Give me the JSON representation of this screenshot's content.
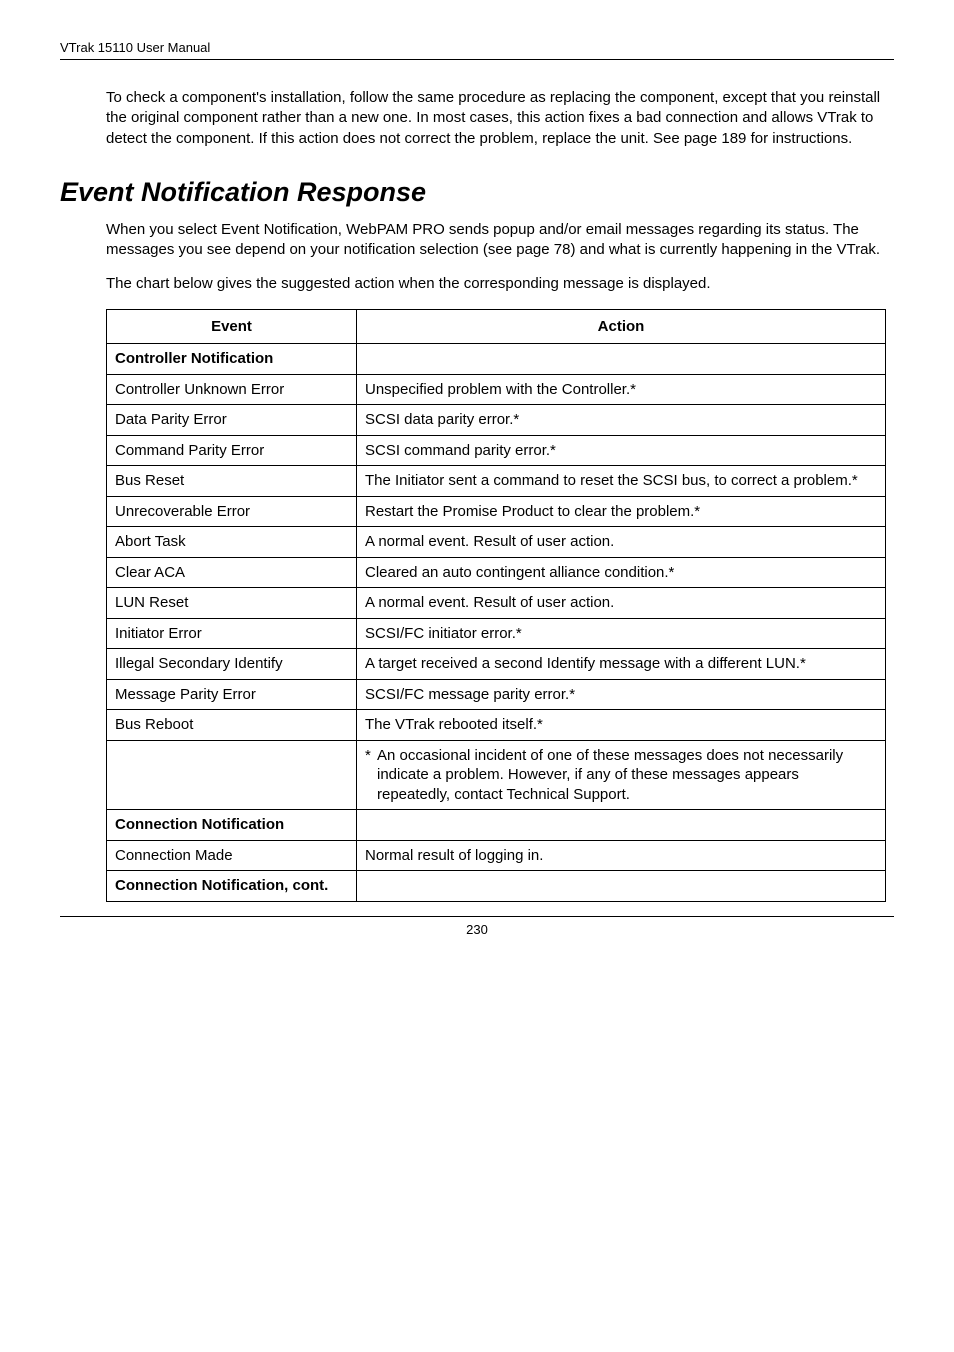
{
  "header": {
    "title": "VTrak 15110 User Manual"
  },
  "intro": "To check a component's installation, follow the same procedure as replacing the component, except that you reinstall the original component rather than a new one. In most cases, this action fixes a bad connection and allows VTrak to detect the component. If this action does not correct the problem, replace the unit. See page 189 for instructions.",
  "section": {
    "title": "Event Notification Response"
  },
  "para1": "When you select Event Notification, WebPAM PRO sends popup and/or email messages regarding its status. The messages you see depend on your notification selection (see page 78) and what is currently happening in the VTrak.",
  "para2": "The chart below gives the suggested action when the corresponding message is displayed.",
  "table": {
    "headers": {
      "event": "Event",
      "action": "Action"
    },
    "rows": [
      {
        "event": "Controller Notification",
        "action": "",
        "bold": true
      },
      {
        "event": "Controller Unknown Error",
        "action": "Unspecified problem with the Controller.*"
      },
      {
        "event": "Data Parity Error",
        "action": "SCSI data parity error.*"
      },
      {
        "event": "Command Parity Error",
        "action": "SCSI command parity error.*"
      },
      {
        "event": "Bus Reset",
        "action": "The Initiator sent a command to reset the SCSI bus, to correct a problem.*"
      },
      {
        "event": "Unrecoverable Error",
        "action": "Restart the Promise Product to clear the problem.*"
      },
      {
        "event": "Abort Task",
        "action": "A normal event. Result of user action."
      },
      {
        "event": "Clear ACA",
        "action": "Cleared an auto contingent alliance condition.*"
      },
      {
        "event": "LUN Reset",
        "action": "A normal event. Result of user action."
      },
      {
        "event": "Initiator Error",
        "action": "SCSI/FC initiator error.*"
      },
      {
        "event": "Illegal Secondary Identify",
        "action": "A target received a second Identify message with a different LUN.*"
      },
      {
        "event": "Message Parity Error",
        "action": "SCSI/FC message parity error.*"
      },
      {
        "event": "Bus Reboot",
        "action": "The VTrak rebooted itself.*"
      },
      {
        "event": "",
        "action": "An occasional incident of one of these messages does not necessarily indicate a problem. However, if any of these messages appears repeatedly, contact Technical Support.",
        "note": true
      },
      {
        "event": "Connection Notification",
        "action": "",
        "bold": true
      },
      {
        "event": "Connection Made",
        "action": "Normal result of logging in."
      },
      {
        "event": "Connection Notification, cont.",
        "action": "",
        "bold": true
      }
    ]
  },
  "footer": {
    "page": "230"
  }
}
